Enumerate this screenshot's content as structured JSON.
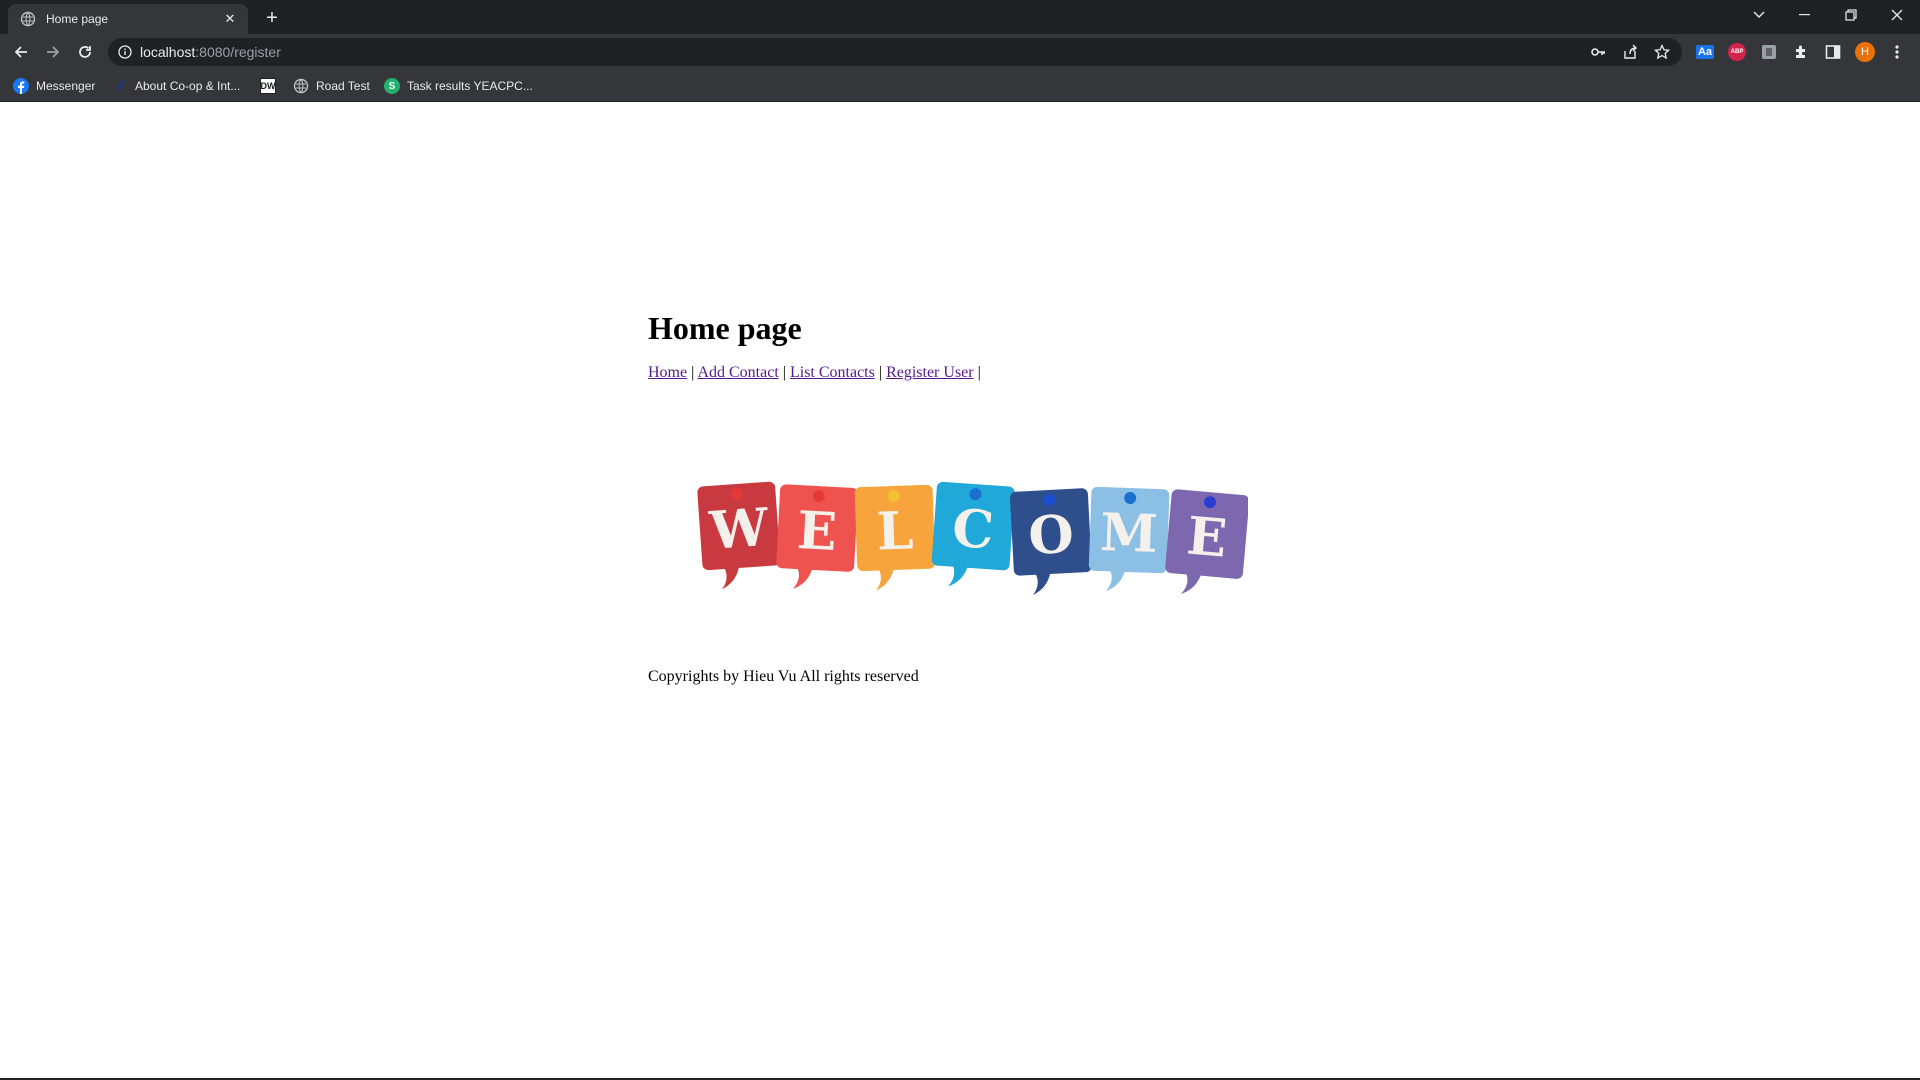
{
  "browser": {
    "tab": {
      "title": "Home page"
    },
    "address": {
      "host": "localhost",
      "rest": ":8080/register"
    },
    "profile_initial": "H",
    "extensions": {
      "translate_label": "Aa",
      "adblock_label": "ABP"
    },
    "bookmarks": [
      {
        "label": "Messenger",
        "icon": "facebook-icon"
      },
      {
        "label": "About Co-op & Int...",
        "icon": "coop-icon"
      },
      {
        "label": "",
        "icon": "dw-icon"
      },
      {
        "label": "Road Test",
        "icon": "globe-icon"
      },
      {
        "label": "Task results YEACPC...",
        "icon": "s-logo-icon"
      }
    ],
    "dw_text": "DW",
    "s_logo_text": "S"
  },
  "page": {
    "heading": "Home page",
    "nav": {
      "home": "Home",
      "add_contact": "Add Contact",
      "list_contacts": "List Contacts",
      "register_user": "Register User",
      "separator": "|"
    },
    "welcome_letters": [
      "W",
      "E",
      "L",
      "C",
      "O",
      "M",
      "E"
    ],
    "welcome_colors": [
      "#c93a40",
      "#ee5350",
      "#f8a43c",
      "#1fa8d8",
      "#2e4f8c",
      "#8bbfe3",
      "#7d68b0"
    ],
    "pin_colors": [
      "#e53935",
      "#e53935",
      "#f2c12e",
      "#1b6fd1",
      "#1b4fd1",
      "#1b6fd1",
      "#2a3fd1"
    ],
    "footer": "Copyrights by Hieu Vu All rights reserved"
  },
  "colors": {
    "chrome_dark": "#202124",
    "chrome_mid": "#35363a",
    "link_visited": "#551a8b",
    "profile": "#e8710a"
  }
}
